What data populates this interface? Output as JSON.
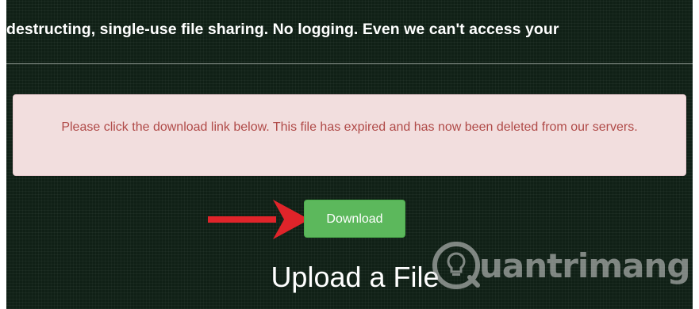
{
  "header": {
    "tagline": "destructing, single-use file sharing. No logging. Even we can't access your"
  },
  "alert": {
    "message": "Please click the download link below. This file has expired and has now been deleted from our servers."
  },
  "actions": {
    "download_label": "Download"
  },
  "upload_section": {
    "title": "Upload a File"
  },
  "watermark": {
    "text": "uantrimang"
  },
  "colors": {
    "background": "#102016",
    "alert_bg": "#f2dede",
    "alert_text": "#b04a48",
    "button_bg": "#5cb85c",
    "arrow": "#e0242a"
  },
  "icons": [
    "red-arrow-pointer-icon",
    "lightbulb-logo-icon"
  ]
}
